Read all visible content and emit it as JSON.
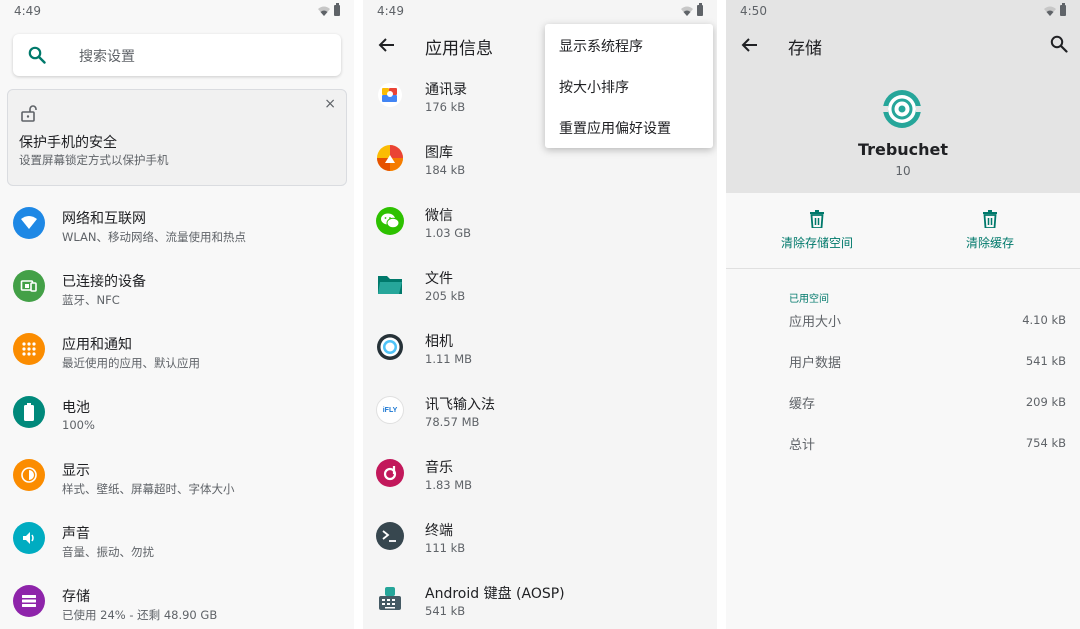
{
  "panel1": {
    "status_time": "4:49",
    "search_placeholder": "搜索设置",
    "security_card": {
      "title": "保护手机的安全",
      "subtitle": "设置屏幕锁定方式以保护手机",
      "close": "×"
    },
    "items": [
      {
        "title": "网络和互联网",
        "subtitle": "WLAN、移动网络、流量使用和热点",
        "icon": "wifi-icon",
        "color": "#1e88e5"
      },
      {
        "title": "已连接的设备",
        "subtitle": "蓝牙、NFC",
        "icon": "devices-icon",
        "color": "#43a047"
      },
      {
        "title": "应用和通知",
        "subtitle": "最近使用的应用、默认应用",
        "icon": "apps-icon",
        "color": "#fb8c00"
      },
      {
        "title": "电池",
        "subtitle": "100%",
        "icon": "battery-icon",
        "color": "#00897b"
      },
      {
        "title": "显示",
        "subtitle": "样式、壁纸、屏幕超时、字体大小",
        "icon": "display-icon",
        "color": "#fb8c00"
      },
      {
        "title": "声音",
        "subtitle": "音量、振动、勿扰",
        "icon": "sound-icon",
        "color": "#00acc1"
      },
      {
        "title": "存储",
        "subtitle": "已使用 24% - 还剩 48.90 GB",
        "icon": "storage-icon",
        "color": "#8e24aa"
      }
    ]
  },
  "panel2": {
    "status_time": "4:49",
    "title": "应用信息",
    "menu": [
      "显示系统程序",
      "按大小排序",
      "重置应用偏好设置"
    ],
    "apps": [
      {
        "name": "通讯录",
        "size": "176 kB",
        "icon": "contacts-icon"
      },
      {
        "name": "图库",
        "size": "184 kB",
        "icon": "gallery-icon"
      },
      {
        "name": "微信",
        "size": "1.03 GB",
        "icon": "wechat-icon"
      },
      {
        "name": "文件",
        "size": "205 kB",
        "icon": "files-icon"
      },
      {
        "name": "相机",
        "size": "1.11 MB",
        "icon": "camera-icon"
      },
      {
        "name": "讯飞输入法",
        "size": "78.57 MB",
        "icon": "ifly-icon"
      },
      {
        "name": "音乐",
        "size": "1.83 MB",
        "icon": "music-icon"
      },
      {
        "name": "终端",
        "size": "111 kB",
        "icon": "terminal-icon"
      },
      {
        "name": "Android 键盘 (AOSP)",
        "size": "541 kB",
        "icon": "keyboard-icon"
      }
    ],
    "ifly_text": "iFLY"
  },
  "panel3": {
    "status_time": "4:50",
    "title": "存储",
    "app_name": "Trebuchet",
    "version": "10",
    "clear_storage": "清除存储空间",
    "clear_cache": "清除缓存",
    "section": "已用空间",
    "rows": [
      {
        "label": "应用大小",
        "value": "4.10 kB"
      },
      {
        "label": "用户数据",
        "value": "541 kB"
      },
      {
        "label": "缓存",
        "value": "209 kB"
      },
      {
        "label": "总计",
        "value": "754 kB"
      }
    ]
  }
}
